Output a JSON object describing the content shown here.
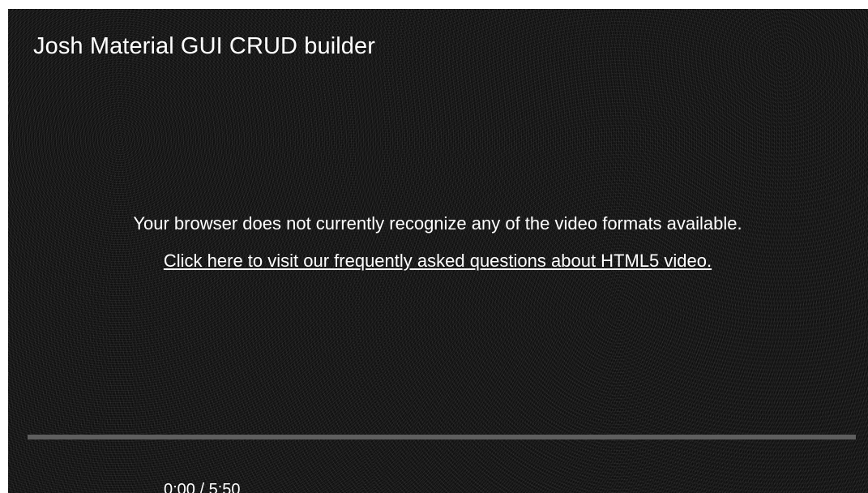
{
  "video": {
    "title": "Josh Material GUI CRUD builder",
    "message": "Your browser does not currently recognize any of the video formats available.",
    "faq_link": "Click here to visit our frequently asked questions about HTML5 video.",
    "time_display": "0:00 / 5:50",
    "progress_fraction": 0
  },
  "colors": {
    "background": "#161616",
    "text": "#ffffff",
    "progress_track": "#5e5e5e"
  }
}
